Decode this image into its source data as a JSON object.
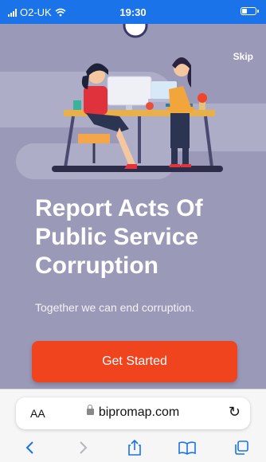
{
  "status_bar": {
    "carrier": "O2-UK",
    "time": "19:30",
    "battery_level": 0.35,
    "wifi_icon": "wifi-icon"
  },
  "onboarding": {
    "skip_label": "Skip",
    "headline_lines": [
      "Report Acts Of",
      "Public Service",
      "Corruption"
    ],
    "subtitle": "Together we can end corruption.",
    "cta_label": "Get Started"
  },
  "browser": {
    "text_size_label": "AA",
    "url": "bipromap.com",
    "icons": [
      "back-icon",
      "forward-icon",
      "share-icon",
      "bookmarks-icon",
      "tabs-icon",
      "reload-icon",
      "lock-icon"
    ]
  },
  "colors": {
    "accent": "#f0441e",
    "background": "#9b99b8",
    "status_bar": "#1a73e8",
    "ios_blue": "#1a73e8"
  }
}
